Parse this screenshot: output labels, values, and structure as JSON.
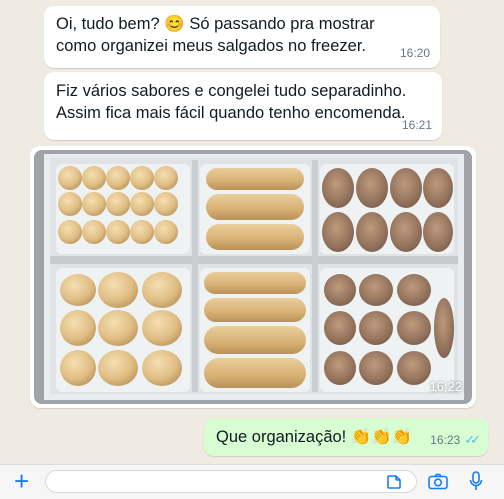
{
  "messages": [
    {
      "text": "Oi, tudo bem? 😊 Só passando pra mostrar\ncomo organizei meus salgados no freezer.",
      "time": "16:20"
    },
    {
      "text": "Fiz vários sabores e congelei tudo separadinho.\nAssim fica mais fácil quando tenho encomenda.",
      "time": "16:21"
    },
    {
      "time": "16:22"
    },
    {
      "text": "Que organização! 👏👏👏",
      "time": "16:23",
      "status": "read"
    }
  ],
  "colors": {
    "chat_bg": "#efeae2",
    "outgoing_bubble": "#d9fdd3",
    "incoming_bubble": "#ffffff",
    "read_ticks": "#53bdeb",
    "accent": "#1a7cf5"
  },
  "input_bar": {
    "icons": [
      "plus-icon",
      "sticker-icon",
      "camera-icon",
      "microphone-icon"
    ]
  }
}
